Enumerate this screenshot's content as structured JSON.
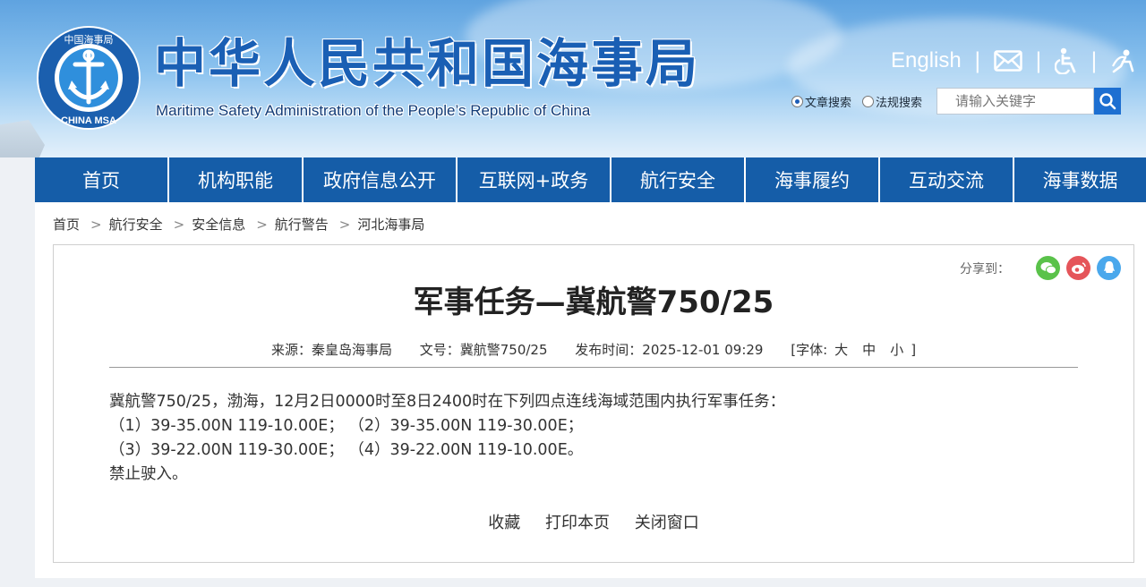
{
  "header": {
    "title": "中华人民共和国海事局",
    "subtitle": "Maritime Safety Administration of the People’s Republic of China",
    "logo_text_top": "中国海事局",
    "logo_text_bottom": "CHINA MSA",
    "english_link": "English",
    "icons": [
      "mail-icon",
      "accessibility-icon",
      "elder-care-icon"
    ],
    "search": {
      "options": [
        "文章搜索",
        "法规搜索"
      ],
      "selected": "文章搜索",
      "placeholder": "请输入关键字"
    }
  },
  "nav": {
    "items": [
      "首页",
      "机构职能",
      "政府信息公开",
      "互联网+政务",
      "航行安全",
      "海事履约",
      "互动交流",
      "海事数据"
    ]
  },
  "breadcrumb": [
    "首页",
    "航行安全",
    "安全信息",
    "航行警告",
    "河北海事局"
  ],
  "article": {
    "share_label": "分享到：",
    "share_icons": [
      "wechat-icon",
      "weibo-icon",
      "qq-icon"
    ],
    "title": "军事任务—冀航警750/25",
    "meta": {
      "source": "来源：秦皇岛海事局",
      "doc_no": "文号：冀航警750/25",
      "published": "发布时间：2025-12-01 09:29",
      "font_size_label": "[字体:",
      "font_sizes": [
        "大",
        "中",
        "小"
      ],
      "font_size_end": "]"
    },
    "body": [
      "冀航警750/25，渤海，12月2日0000时至8日2400时在下列四点连线海域范围内执行军事任务：",
      "（1）39-35.00N 119-10.00E；  （2）39-35.00N 119-30.00E；",
      "（3）39-22.00N 119-30.00E；  （4）39-22.00N 119-10.00E。",
      "禁止驶入。"
    ],
    "actions": [
      "收藏",
      "打印本页",
      "关闭窗口"
    ]
  },
  "colors": {
    "nav_bg": "#155da8",
    "title_blue": "#1a5fb4",
    "wechat": "#5ac24a",
    "weibo": "#e5555a",
    "qq": "#4aa8ec"
  }
}
